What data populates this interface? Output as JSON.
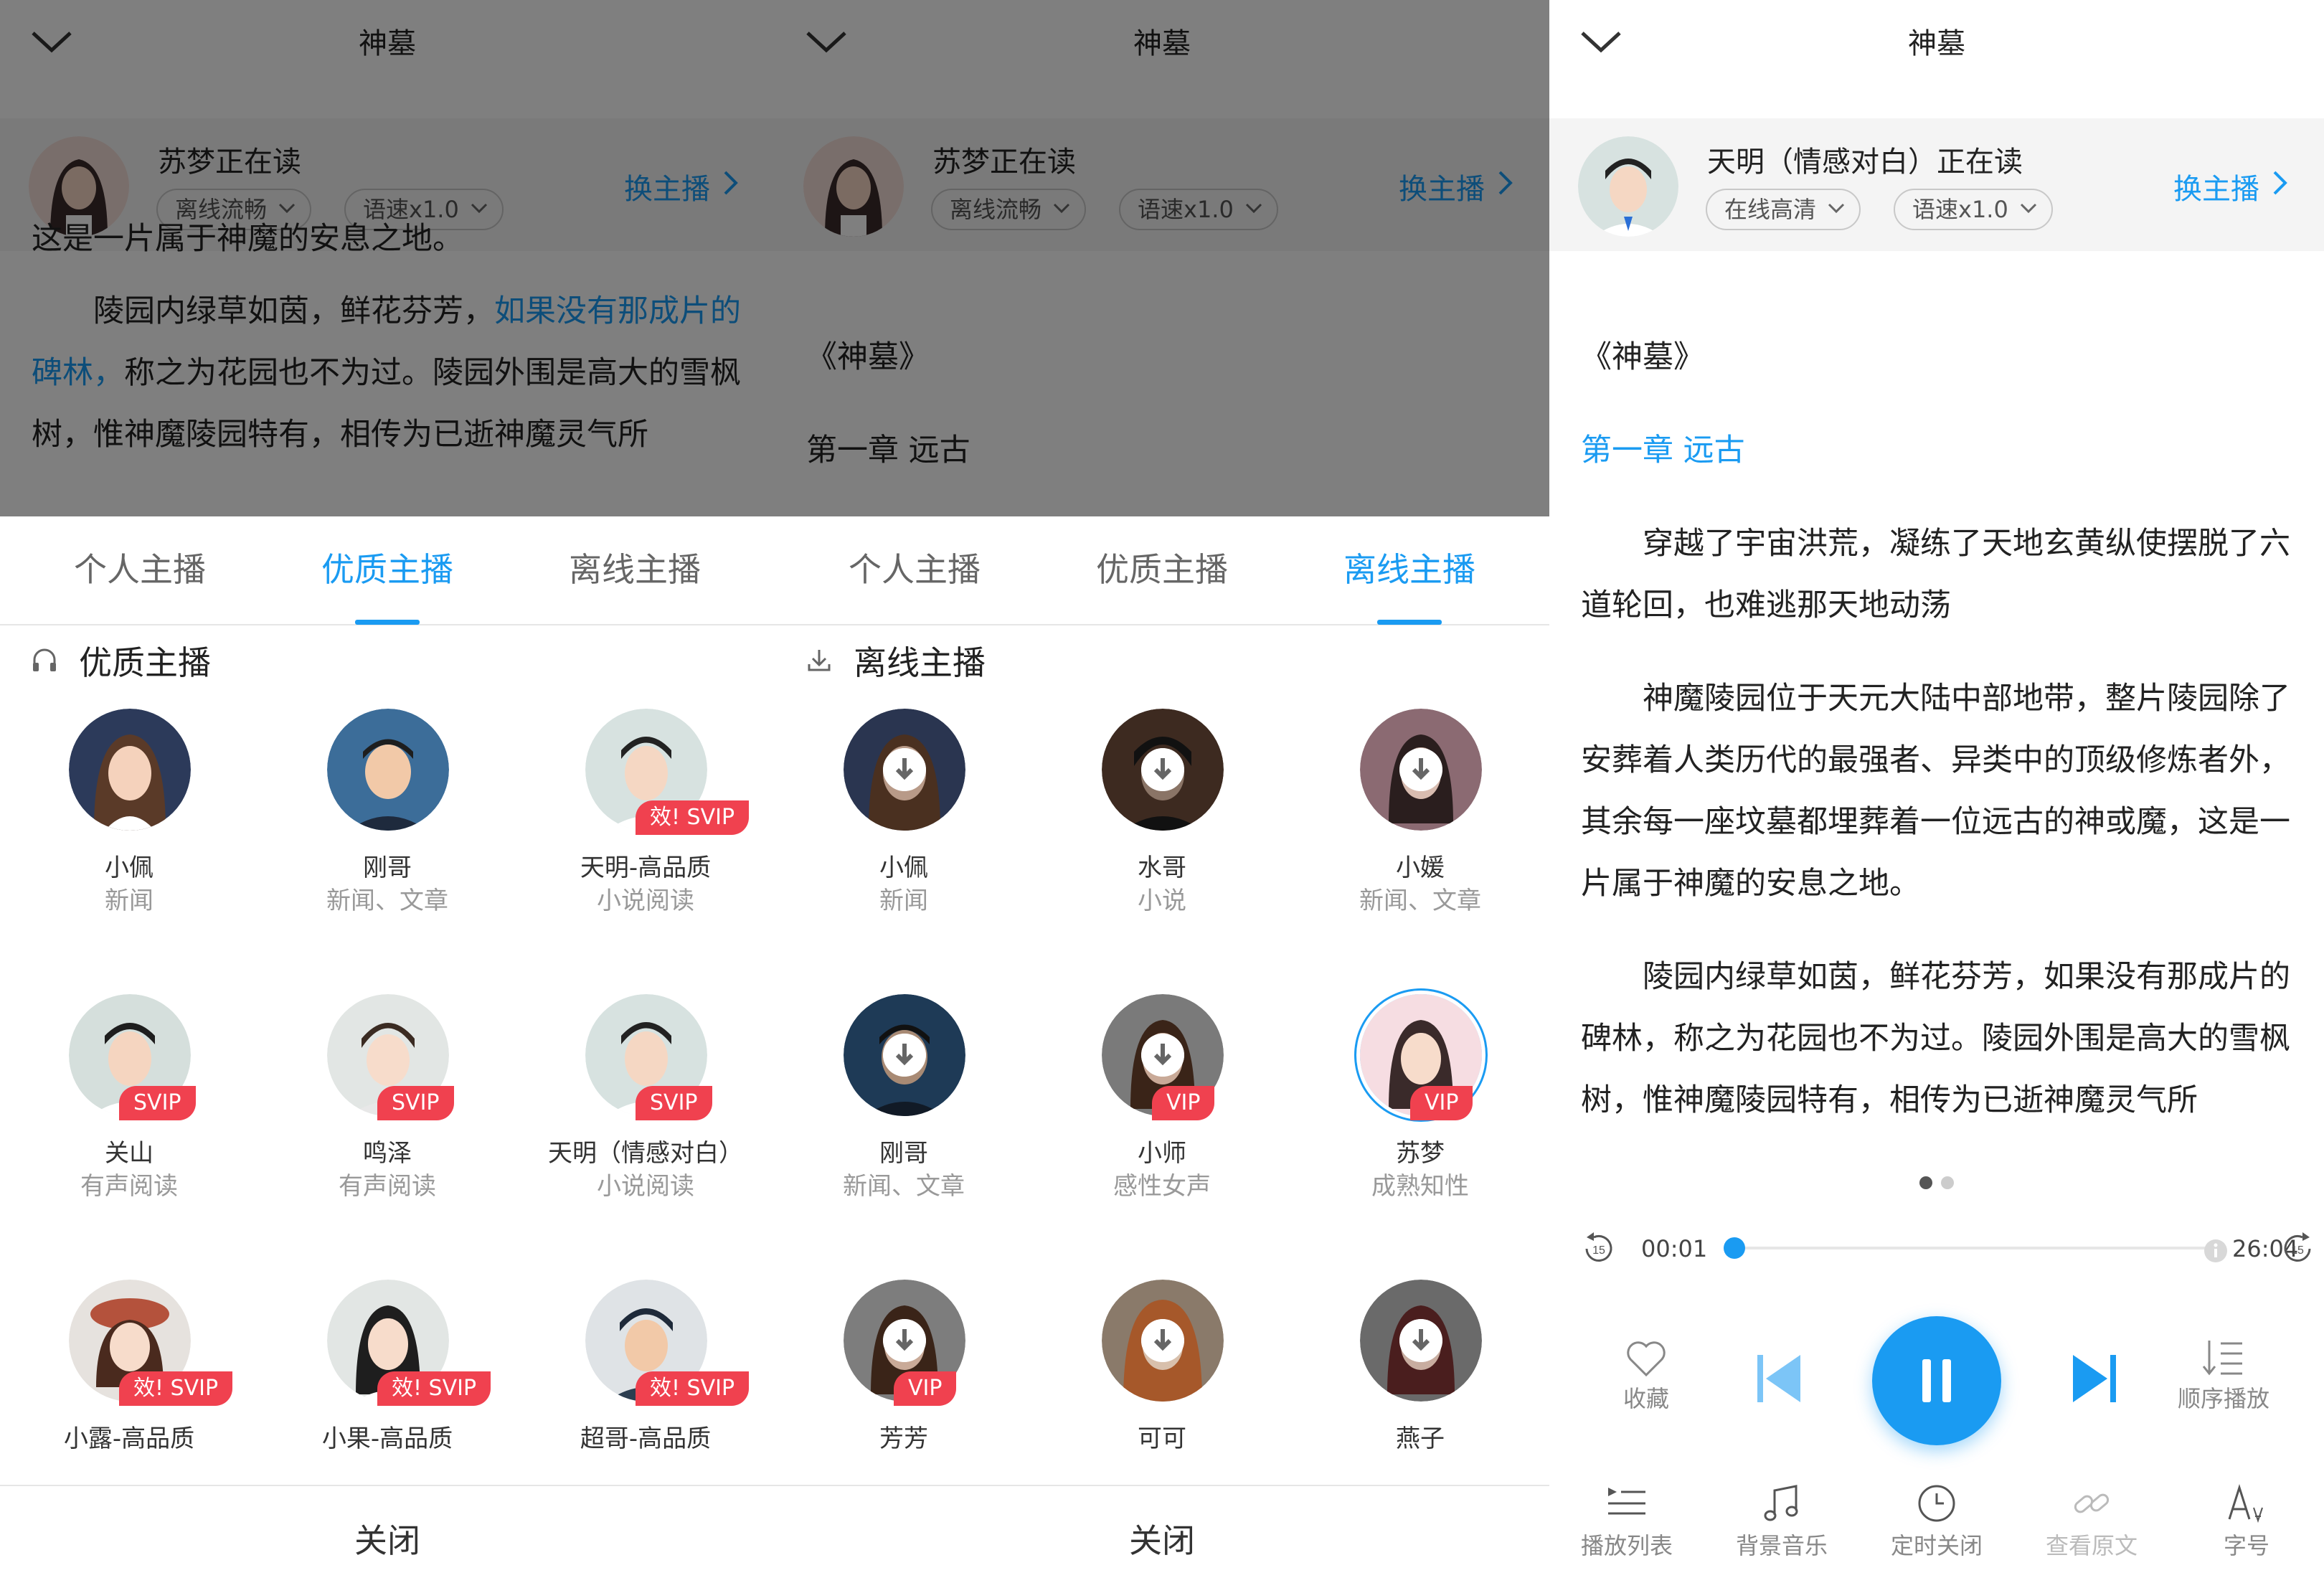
{
  "colors": {
    "accent": "#1a9bf2",
    "badge": "#f0414f"
  },
  "book_title": "神墓",
  "reader_tabs": [
    "个人主播",
    "优质主播",
    "离线主播"
  ],
  "close_label": "关闭",
  "panel1": {
    "reader": "苏梦正在读",
    "mode": "离线流畅",
    "speed": "语速x1.0",
    "switch": "换主播",
    "text_top": "这是一片属于神魔的安息之地。",
    "para_plain": "陵园内绿草如茵，鲜花芬芳，",
    "para_link": "如果没有那成片的碑林，",
    "para_rest": "称之为花园也不为过。陵园外围是高大的雪枫树，惟神魔陵园特有，相传为已逝神魔灵气所",
    "section": "优质主播",
    "anchors": [
      {
        "name": "小佩",
        "sub": "新闻",
        "badge": ""
      },
      {
        "name": "刚哥",
        "sub": "新闻、文章",
        "badge": ""
      },
      {
        "name": "天明-高品质",
        "sub": "小说阅读",
        "badge": "效! SVIP"
      },
      {
        "name": "关山",
        "sub": "有声阅读",
        "badge": "SVIP"
      },
      {
        "name": "鸣泽",
        "sub": "有声阅读",
        "badge": "SVIP"
      },
      {
        "name": "天明（情感对白）",
        "sub": "小说阅读",
        "badge": "SVIP"
      },
      {
        "name": "小露-高品质",
        "sub": "",
        "badge": "效! SVIP"
      },
      {
        "name": "小果-高品质",
        "sub": "",
        "badge": "效! SVIP"
      },
      {
        "name": "超哥-高品质",
        "sub": "",
        "badge": "效! SVIP"
      }
    ]
  },
  "panel2": {
    "reader": "苏梦正在读",
    "mode": "离线流畅",
    "speed": "语速x1.0",
    "switch": "换主播",
    "book_name": "《神墓》",
    "chapter": "第一章 远古",
    "section": "离线主播",
    "anchors": [
      {
        "name": "小佩",
        "sub": "新闻",
        "badge": ""
      },
      {
        "name": "水哥",
        "sub": "小说",
        "badge": ""
      },
      {
        "name": "小媛",
        "sub": "新闻、文章",
        "badge": ""
      },
      {
        "name": "刚哥",
        "sub": "新闻、文章",
        "badge": ""
      },
      {
        "name": "小师",
        "sub": "感性女声",
        "badge": "VIP"
      },
      {
        "name": "苏梦",
        "sub": "成熟知性",
        "badge": "VIP"
      },
      {
        "name": "芳芳",
        "sub": "",
        "badge": "VIP"
      },
      {
        "name": "可可",
        "sub": "",
        "badge": ""
      },
      {
        "name": "燕子",
        "sub": "",
        "badge": ""
      }
    ]
  },
  "panel3": {
    "reader": "天明（情感对白）正在读",
    "mode": "在线高清",
    "speed": "语速x1.0",
    "switch": "换主播",
    "book_name": "《神墓》",
    "chapter": "第一章 远古",
    "paragraphs": [
      "穿越了宇宙洪荒，凝练了天地玄黄纵使摆脱了六道轮回，也难逃那天地动荡",
      "神魔陵园位于天元大陆中部地带，整片陵园除了安葬着人类历代的最强者、异类中的顶级修炼者外，其余每一座坟墓都埋葬着一位远古的神或魔，这是一片属于神魔的安息之地。",
      "陵园内绿草如茵，鲜花芬芳，如果没有那成片的碑林，称之为花园也不为过。陵园外围是高大的雪枫树，惟神魔陵园特有，相传为已逝神魔灵气所"
    ],
    "time_current": "00:01",
    "time_total": "26:04",
    "progress_fraction": 0.005,
    "rewind_label": "15",
    "forward_label": "15",
    "favorite": "收藏",
    "order_play": "顺序播放",
    "bottom": [
      "播放列表",
      "背景音乐",
      "定时关闭",
      "查看原文",
      "字号"
    ]
  }
}
